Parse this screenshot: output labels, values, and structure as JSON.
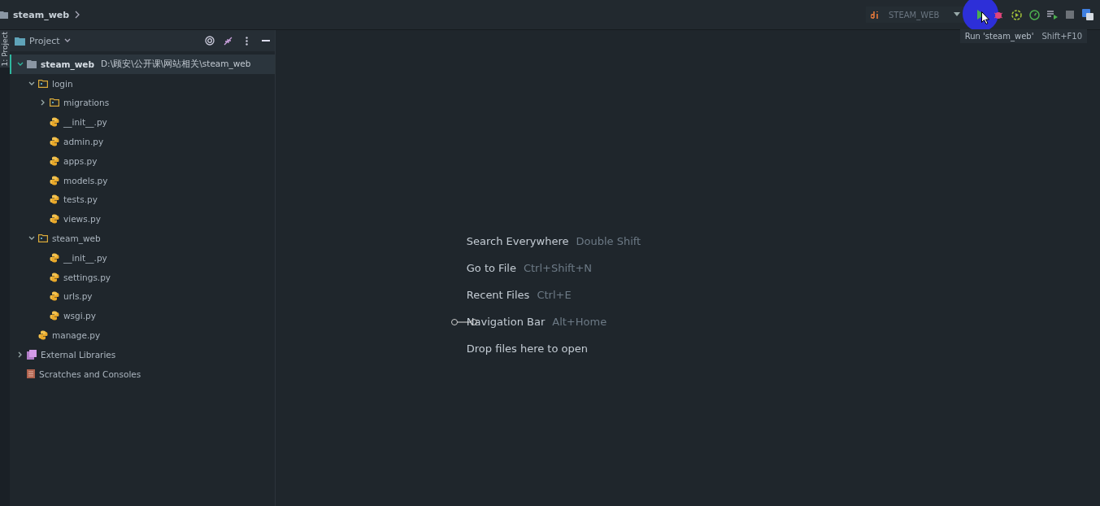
{
  "navbar": {
    "breadcrumb": "steam_web",
    "run_config": "STEAM_WEB"
  },
  "tooltip": {
    "text": "Run 'steam_web'",
    "shortcut": "Shift+F10"
  },
  "side_strip": {
    "label": "1: Project"
  },
  "project_panel": {
    "title": "Project"
  },
  "tree": [
    {
      "kind": "module",
      "label": "steam_web",
      "path": "D:\\顾安\\公开课\\网站相关\\steam_web",
      "selected": true,
      "expanded": true,
      "children": [
        {
          "kind": "folder",
          "label": "login",
          "selected": false,
          "expanded": true,
          "children": [
            {
              "kind": "folder",
              "label": "migrations",
              "selected": false,
              "expanded": false
            },
            {
              "kind": "python",
              "label": "__init__.py",
              "selected": false
            },
            {
              "kind": "python",
              "label": "admin.py",
              "selected": false
            },
            {
              "kind": "python",
              "label": "apps.py",
              "selected": false
            },
            {
              "kind": "python",
              "label": "models.py",
              "selected": false
            },
            {
              "kind": "python",
              "label": "tests.py",
              "selected": false
            },
            {
              "kind": "python",
              "label": "views.py",
              "selected": false
            }
          ]
        },
        {
          "kind": "folder",
          "label": "steam_web",
          "selected": false,
          "expanded": true,
          "children": [
            {
              "kind": "python",
              "label": "__init__.py",
              "selected": false
            },
            {
              "kind": "python",
              "label": "settings.py",
              "selected": false
            },
            {
              "kind": "python",
              "label": "urls.py",
              "selected": false
            },
            {
              "kind": "python",
              "label": "wsgi.py",
              "selected": false
            }
          ]
        },
        {
          "kind": "python",
          "label": "manage.py",
          "selected": false
        }
      ]
    },
    {
      "kind": "libraries",
      "label": "External Libraries",
      "selected": false,
      "expanded": false
    },
    {
      "kind": "scratches",
      "label": "Scratches and Consoles",
      "selected": false
    }
  ],
  "hints": [
    {
      "action": "Search Everywhere",
      "shortcut": "Double Shift"
    },
    {
      "action": "Go to File",
      "shortcut": "Ctrl+Shift+N"
    },
    {
      "action": "Recent Files",
      "shortcut": "Ctrl+E"
    },
    {
      "action": "Navigation Bar",
      "shortcut": "Alt+Home"
    },
    {
      "action": "Drop files here to open"
    }
  ]
}
